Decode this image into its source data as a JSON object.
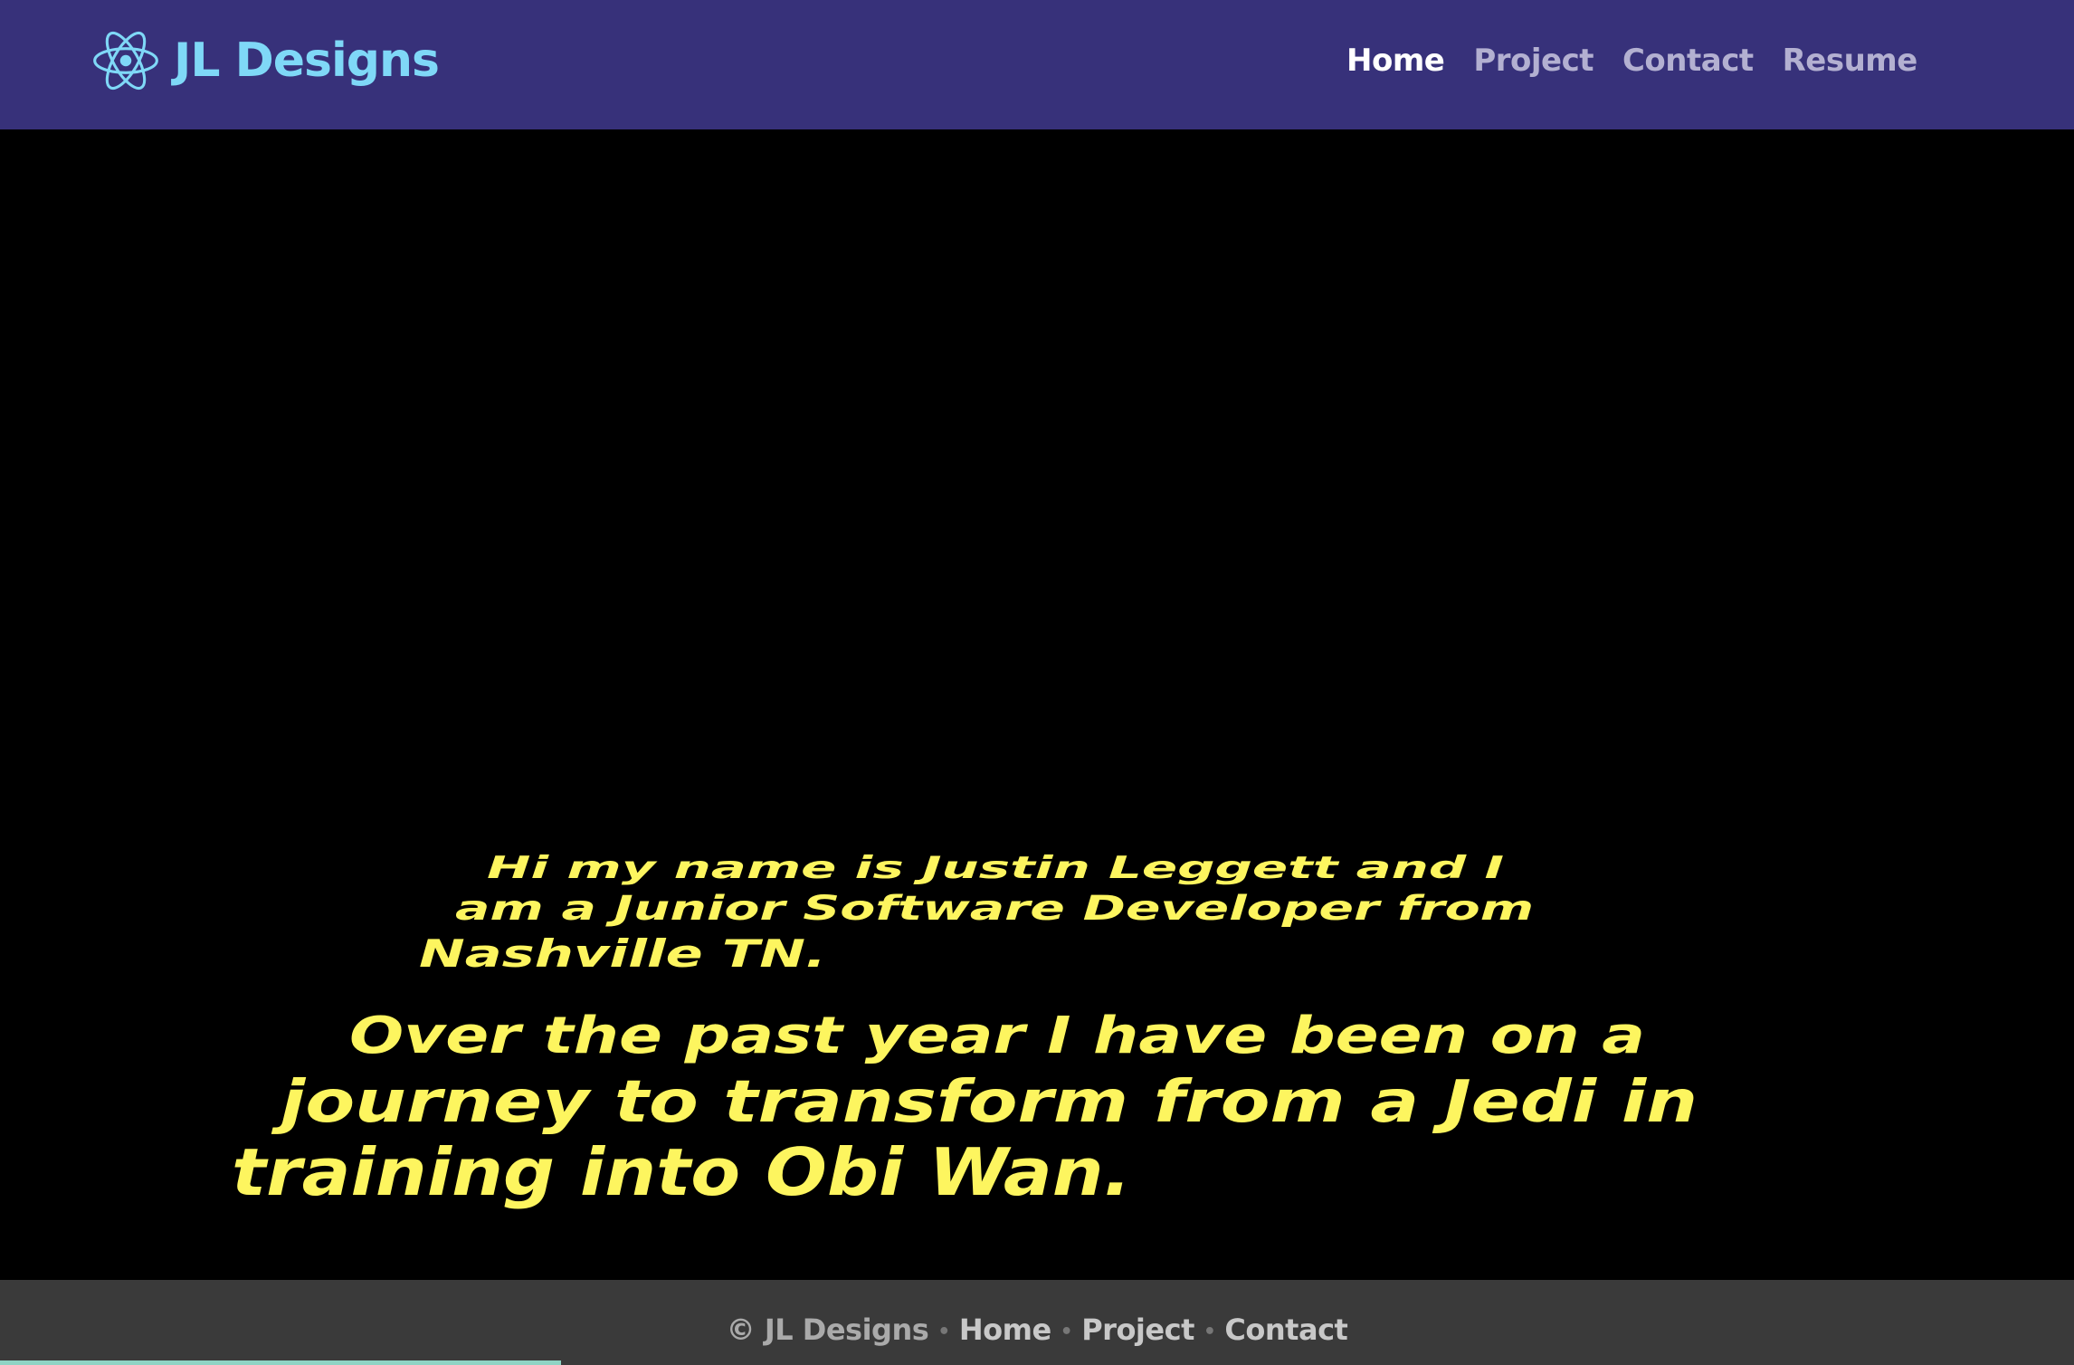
{
  "brand": {
    "name": "JL Designs",
    "logo_icon": "react-atom-icon",
    "color": "#7fd8f7"
  },
  "nav": {
    "items": [
      {
        "label": "Home",
        "active": true
      },
      {
        "label": "Project",
        "active": false
      },
      {
        "label": "Contact",
        "active": false
      },
      {
        "label": "Resume",
        "active": false
      }
    ],
    "background": "#37317a"
  },
  "crawl": {
    "text_color": "#fdf55f",
    "paragraph1": [
      "Hi my name is Justin Leggett and I",
      "am a Junior Software Developer from",
      "Nashville TN."
    ],
    "paragraph2": [
      "Over the past year I have been on a",
      "journey to transform from a Jedi in",
      "training into Obi Wan."
    ]
  },
  "footer": {
    "copyright": "© JL Designs",
    "links": [
      "Home",
      "Project",
      "Contact"
    ],
    "background": "#3a3a3a"
  }
}
